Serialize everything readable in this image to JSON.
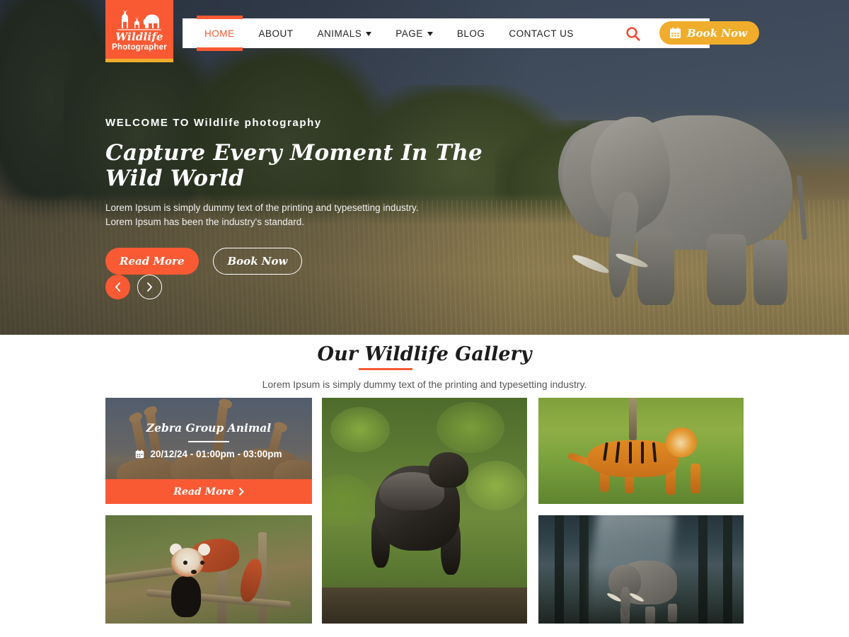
{
  "brand": {
    "name_line1": "Wildlife",
    "name_line2": "Photographer",
    "icon": "wildlife-animals-icon",
    "color": "#f95a34",
    "accent_strip": "#f0ad2b"
  },
  "nav": {
    "items": [
      {
        "label": "HOME",
        "active": true,
        "has_dropdown": false
      },
      {
        "label": "ABOUT",
        "active": false,
        "has_dropdown": false
      },
      {
        "label": "ANIMALS",
        "active": false,
        "has_dropdown": true
      },
      {
        "label": "PAGE",
        "active": false,
        "has_dropdown": true
      },
      {
        "label": "BLOG",
        "active": false,
        "has_dropdown": false
      },
      {
        "label": "CONTACT US",
        "active": false,
        "has_dropdown": false
      }
    ],
    "search_icon": "search-icon",
    "book_button": {
      "label": "Book Now",
      "icon": "calendar-icon",
      "color": "#f0ad2b"
    }
  },
  "hero": {
    "eyebrow": "WELCOME TO Wildlife photography",
    "title": "Capture Every Moment In The Wild World",
    "desc_line1": "Lorem Ipsum is simply dummy text of the printing and typesetting industry.",
    "desc_line2": "Lorem Ipsum has been the industry's standard.",
    "primary_button": "Read More",
    "secondary_button": "Book Now",
    "prev_icon": "chevron-left-icon",
    "next_icon": "chevron-right-icon"
  },
  "gallery": {
    "title": "Our Wildlife Gallery",
    "subtitle": "Lorem Ipsum is simply dummy text of the printing and typesetting industry.",
    "card": {
      "title": "Zebra Group Animal",
      "date": "20/12/24 - 01:00pm - 03:00pm",
      "date_icon": "calendar-icon",
      "more_label": "Read More",
      "more_icon": "chevron-right-icon",
      "bar_color": "#f95a34"
    },
    "photos": [
      {
        "name": "giraffe-group-photo"
      },
      {
        "name": "red-panda-photo"
      },
      {
        "name": "gorilla-photo"
      },
      {
        "name": "tiger-photo"
      },
      {
        "name": "forest-elephant-photo"
      }
    ]
  }
}
